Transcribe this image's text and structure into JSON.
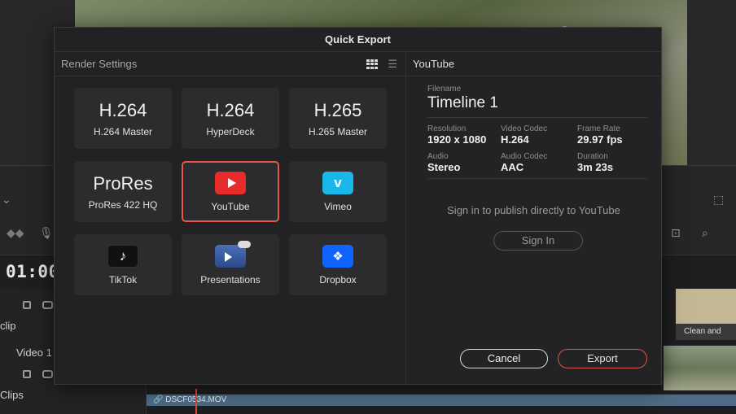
{
  "background": {
    "timecode": "01:00:",
    "track_labels": [
      "clip",
      "Video 1",
      "Clips"
    ],
    "clip_name": "DSCF0534.MOV",
    "clean_button": "Clean and"
  },
  "dialog": {
    "title": "Quick Export",
    "left_header": "Render Settings",
    "presets": [
      {
        "big": "H.264",
        "sub": "H.264 Master"
      },
      {
        "big": "H.264",
        "sub": "HyperDeck"
      },
      {
        "big": "H.265",
        "sub": "H.265 Master"
      },
      {
        "big": "ProRes",
        "sub": "ProRes 422 HQ"
      },
      {
        "logo": "youtube-icon",
        "sub": "YouTube",
        "selected": true
      },
      {
        "logo": "vimeo-icon",
        "sub": "Vimeo"
      },
      {
        "logo": "tiktok-icon",
        "sub": "TikTok"
      },
      {
        "logo": "presentations-icon",
        "sub": "Presentations"
      },
      {
        "logo": "dropbox-icon",
        "sub": "Dropbox"
      }
    ],
    "right_header": "YouTube",
    "filename_label": "Filename",
    "filename": "Timeline 1",
    "resolution_label": "Resolution",
    "resolution": "1920 x 1080",
    "video_codec_label": "Video Codec",
    "video_codec": "H.264",
    "frame_rate_label": "Frame Rate",
    "frame_rate": "29.97 fps",
    "audio_label": "Audio",
    "audio": "Stereo",
    "audio_codec_label": "Audio Codec",
    "audio_codec": "AAC",
    "duration_label": "Duration",
    "duration": "3m 23s",
    "signin_message": "Sign in to publish directly to YouTube",
    "signin_button": "Sign In",
    "cancel_button": "Cancel",
    "export_button": "Export"
  },
  "colors": {
    "accent": "#e5574b",
    "youtube": "#e82b2b",
    "vimeo": "#1ab7ea",
    "dropbox": "#0d64ff"
  }
}
